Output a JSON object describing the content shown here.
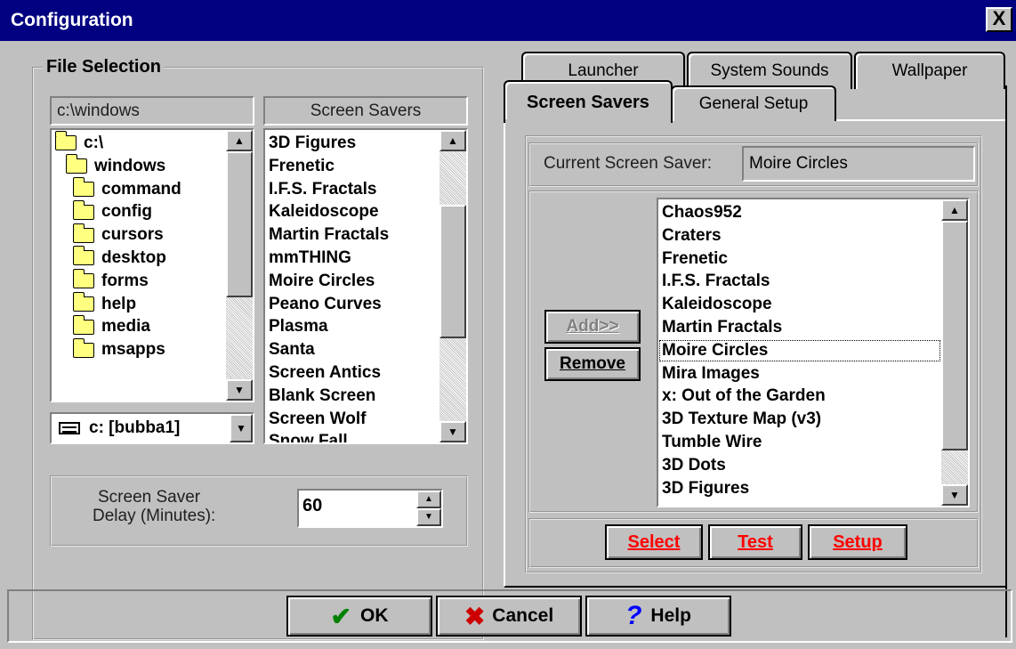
{
  "window": {
    "title": "Configuration",
    "close_label": "X"
  },
  "file_selection": {
    "group_label": "File Selection",
    "path_label": "c:\\windows",
    "savers_header": "Screen Savers",
    "folders": [
      "c:\\",
      "windows",
      "command",
      "config",
      "cursors",
      "desktop",
      "forms",
      "help",
      "media",
      "msapps"
    ],
    "drive_select": "c: [bubba1]",
    "screen_savers": [
      "3D Figures",
      "Frenetic",
      "I.F.S. Fractals",
      "Kaleidoscope",
      "Martin Fractals",
      "mmTHING",
      "Moire Circles",
      "Peano Curves",
      "Plasma",
      "Santa",
      "Screen Antics",
      "Blank Screen",
      "Screen Wolf",
      "Snow Fall"
    ],
    "delay_label_line1": "Screen Saver",
    "delay_label_line2": "Delay (Minutes):",
    "delay_value": "60"
  },
  "tabs": {
    "back_row": [
      "Launcher",
      "System Sounds",
      "Wallpaper"
    ],
    "front_row": [
      "Screen Savers",
      "General Setup"
    ],
    "active": "Screen Savers"
  },
  "saver_panel": {
    "current_label": "Current Screen Saver:",
    "current_value": "Moire Circles",
    "add_label": "Add>>",
    "remove_label": "Remove",
    "selected_list": [
      "Chaos952",
      "Craters",
      "Frenetic",
      "I.F.S. Fractals",
      "Kaleidoscope",
      "Martin Fractals",
      "Moire Circles",
      "Mira Images",
      "x: Out of the Garden",
      "3D Texture Map (v3)",
      "Tumble Wire",
      "3D Dots",
      "3D Figures"
    ],
    "focused_item": "Moire Circles",
    "select_label": "Select",
    "test_label": "Test",
    "setup_label": "Setup"
  },
  "footer": {
    "ok_label": "OK",
    "cancel_label": "Cancel",
    "help_label": "Help"
  },
  "colors": {
    "titlebar": "#000080",
    "face": "#c0c0c0",
    "accent_red": "#ff0000",
    "ok_green": "#008000",
    "help_blue": "#0000ff"
  }
}
